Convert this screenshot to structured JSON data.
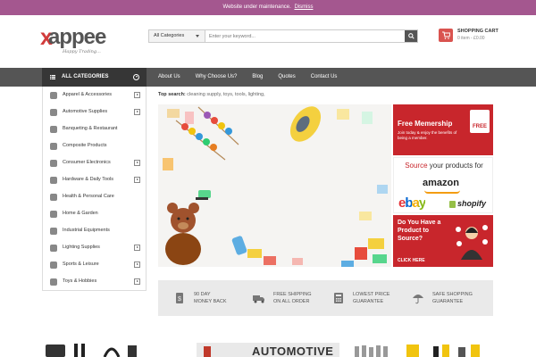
{
  "topbar": {
    "message": "Website under maintenance.",
    "dismiss": "Dismiss"
  },
  "logo": {
    "letter": "x",
    "word": "appee",
    "tagline": "Happy Trading..."
  },
  "search": {
    "category": "All Categories",
    "placeholder": "Enter your keyword..."
  },
  "cart": {
    "title": "SHOPPING CART",
    "summary": "0 item - £0.00"
  },
  "nav": {
    "all_categories": "ALL CATEGORIES",
    "links": [
      "About Us",
      "Why Choose Us?",
      "Blog",
      "Quotes",
      "Contact Us"
    ]
  },
  "categories": [
    {
      "label": "Apparel & Accessories",
      "arrow": true
    },
    {
      "label": "Automotive Supplies",
      "arrow": true
    },
    {
      "label": "Banqueting & Restaurant",
      "arrow": false
    },
    {
      "label": "Composite Products",
      "arrow": false
    },
    {
      "label": "Consumer Electronics",
      "arrow": true
    },
    {
      "label": "Hardware & Daily Tools",
      "arrow": true
    },
    {
      "label": "Health & Personal Care",
      "arrow": false
    },
    {
      "label": "Home & Garden",
      "arrow": false
    },
    {
      "label": "Industrial Equipments",
      "arrow": false
    },
    {
      "label": "Lighting Supplies",
      "arrow": true
    },
    {
      "label": "Sports & Leisure",
      "arrow": true
    },
    {
      "label": "Toys & Hobbies",
      "arrow": true
    }
  ],
  "top_search": {
    "label": "Top search:",
    "terms": "cleaning supply, toys, tools, lighting,"
  },
  "ads": {
    "membership": {
      "title": "Free Memership",
      "body": "Join today & enjoy the benefits of being a member.",
      "badge": "FREE"
    },
    "source": {
      "lead": "Source",
      "rest": "your products for",
      "amazon": "amazon",
      "ebay": "ebay",
      "shopify": "shopify"
    },
    "product": {
      "title": "Do You Have a Product to Source?",
      "cta": "CLICK HERE"
    }
  },
  "features": [
    {
      "icon": "money-icon",
      "line1": "90 DAY",
      "line2": "MONEY BACK"
    },
    {
      "icon": "truck-icon",
      "line1": "FREE SHIPPING",
      "line2": "ON ALL ORDER"
    },
    {
      "icon": "calculator-icon",
      "line1": "LOWEST PRICE",
      "line2": "GUARANTEE"
    },
    {
      "icon": "umbrella-icon",
      "line1": "SAFE SHOPPING",
      "line2": "GUARANTEE"
    }
  ],
  "bottom_banner": {
    "text": "AUTOMOTIVE"
  },
  "colors": {
    "topbar": "#a4578f",
    "nav": "#555555",
    "accent": "#c8262c",
    "feature_bg": "#eaeaea"
  }
}
